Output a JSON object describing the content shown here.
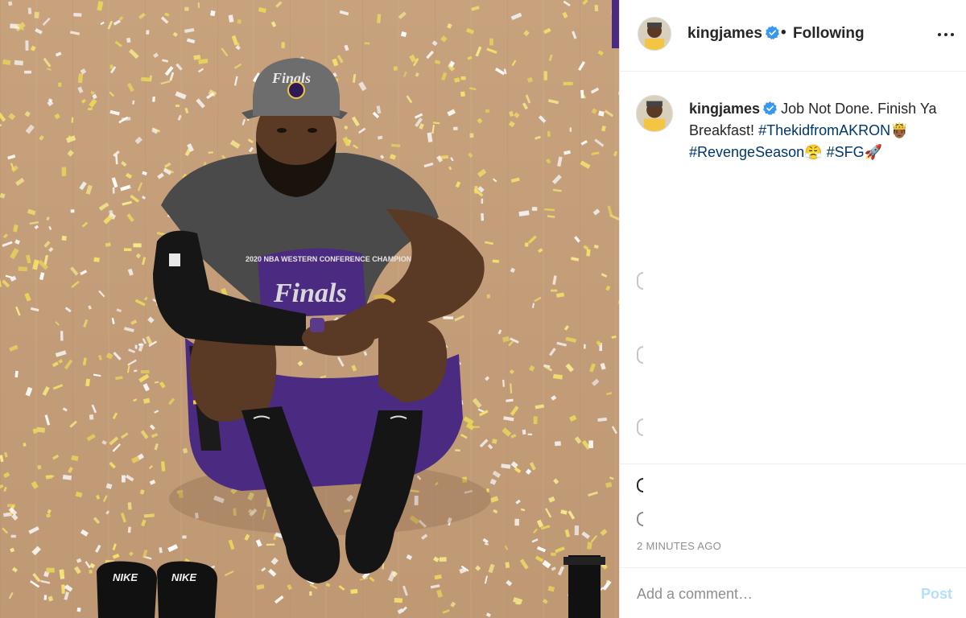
{
  "header": {
    "username": "kingjames",
    "separator": "•",
    "follow_status": "Following"
  },
  "caption": {
    "username": "kingjames",
    "text_part1": "Job Not Done. Finish Ya Breakfast!",
    "hashtag1": "#ThekidfromAKRON",
    "emoji1": "🤴🏾",
    "hashtag2": "#RevengeSeason",
    "emoji2": "😤",
    "hashtag3": "#SFG",
    "emoji3": "🚀"
  },
  "timestamp": "2 MINUTES AGO",
  "comment": {
    "placeholder": "Add a comment…",
    "post_label": "Post"
  },
  "photo": {
    "cap_text": "Finals",
    "slide_brand": "NIKE"
  },
  "colors": {
    "verified": "#3897f0",
    "hashtag": "#00376b",
    "post_disabled": "#b2dffc",
    "timestamp": "#8e8e8e"
  },
  "icons": [
    "verified-badge-icon",
    "more-options-icon"
  ]
}
